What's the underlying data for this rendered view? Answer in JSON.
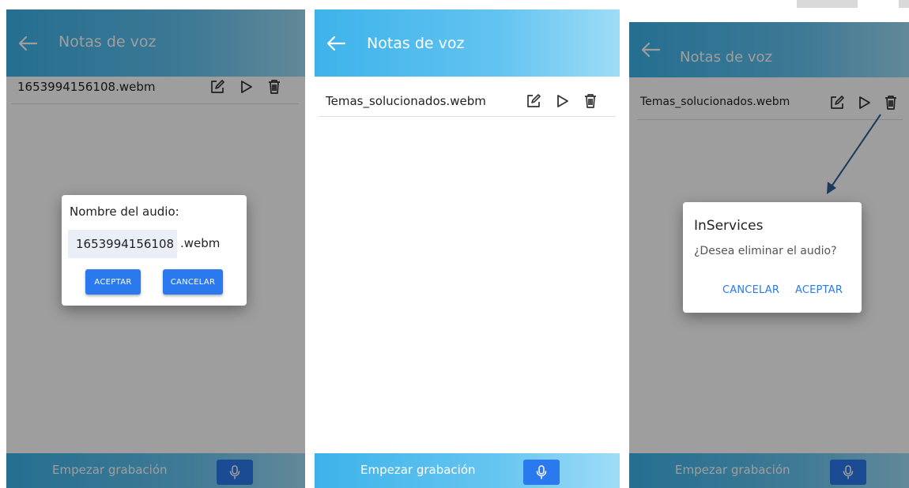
{
  "app": {
    "title": "Notas de voz",
    "record_label": "Empezar grabación"
  },
  "screen1": {
    "item_name": "1653994156108.webm",
    "dialog": {
      "title": "Nombre del audio:",
      "input_value": "1653994156108",
      "extension": ".webm",
      "accept_label": "ACEPTAR",
      "cancel_label": "CANCELAR"
    }
  },
  "screen2": {
    "item_name": "Temas_solucionados.webm"
  },
  "screen3": {
    "item_name": "Temas_solucionados.webm",
    "dialog": {
      "title": "InServices",
      "message": "¿Desea eliminar el audio?",
      "cancel_label": "CANCELAR",
      "accept_label": "ACEPTAR"
    }
  },
  "icons": {
    "back": "arrow-left-icon",
    "edit": "edit-icon",
    "play": "play-icon",
    "delete": "trash-icon",
    "mic": "microphone-icon"
  },
  "colors": {
    "header_gradient_start": "#3db3ea",
    "header_gradient_end": "#9fdcf7",
    "primary_button": "#2a79ee",
    "annotation_arrow": "#1f3a5f"
  }
}
